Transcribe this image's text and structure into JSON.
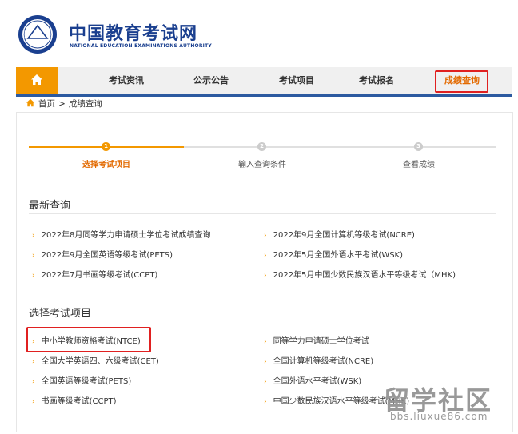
{
  "brand": {
    "title_cn": "中国教育考试网",
    "title_en": "NATIONAL EDUCATION EXAMINATIONS AUTHORITY",
    "logo_text": "NEEA"
  },
  "nav": {
    "home_icon": "home-icon",
    "items": [
      "考试资讯",
      "公示公告",
      "考试项目",
      "考试报名",
      "成绩查询"
    ]
  },
  "breadcrumb": {
    "home": "首页",
    "separator": ">",
    "current": "成绩查询"
  },
  "steps": [
    {
      "num": "1",
      "label": "选择考试项目"
    },
    {
      "num": "2",
      "label": "输入查询条件"
    },
    {
      "num": "3",
      "label": "查看成绩"
    }
  ],
  "latest": {
    "title": "最新查询",
    "links": [
      "2022年8月同等学力申请硕士学位考试成绩查询",
      "2022年9月全国计算机等级考试(NCRE)",
      "2022年9月全国英语等级考试(PETS)",
      "2022年5月全国外语水平考试(WSK)",
      "2022年7月书画等级考试(CCPT)",
      "2022年5月中国少数民族汉语水平等级考试（MHK)"
    ]
  },
  "choose": {
    "title": "选择考试项目",
    "links": [
      "中小学教师资格考试(NTCE)",
      "同等学力申请硕士学位考试",
      "全国大学英语四、六级考试(CET)",
      "全国计算机等级考试(NCRE)",
      "全国英语等级考试(PETS)",
      "全国外语水平考试(WSK)",
      "书画等级考试(CCPT)",
      "中国少数民族汉语水平等级考试(MHK)"
    ]
  },
  "watermark": {
    "main": "留学社区",
    "sub": "bbs.liuxue86.com"
  },
  "colors": {
    "accent": "#f39800",
    "brand_blue": "#1a3f8f",
    "highlight_red": "#e02020",
    "inactive_gray": "#cccccc"
  }
}
